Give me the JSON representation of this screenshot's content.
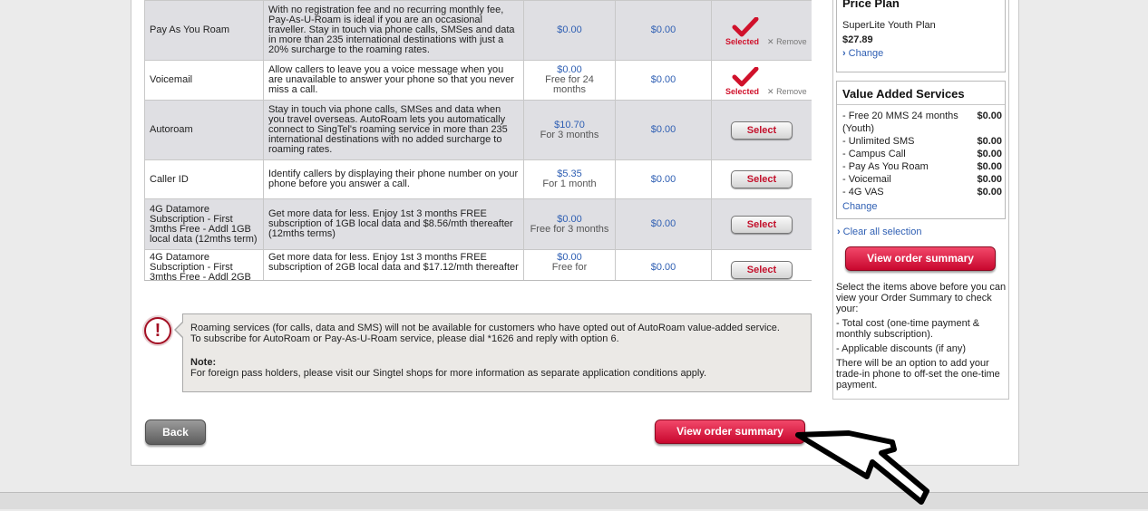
{
  "services": [
    {
      "name": "Pay As You Roam",
      "description": "With no registration fee and no recurring monthly fee, Pay-As-U-Roam is ideal if you are an occasional traveller. Stay in touch via phone calls, SMSes and data in more than 235 international destinations with just a 20% surcharge to the roaming rates.",
      "price": "$0.00",
      "price_note": "",
      "price2": "$0.00",
      "status": "selected"
    },
    {
      "name": "Voicemail",
      "description": "Allow callers to leave you a voice message when you are unavailable to answer your phone so that you never miss a call.",
      "price": "$0.00",
      "price_note": "Free for 24 months",
      "price2": "$0.00",
      "status": "selected"
    },
    {
      "name": "Autoroam",
      "description": "Stay in touch via phone calls, SMSes and data when you travel overseas. AutoRoam lets you automatically connect to SingTel's roaming service in more than 235 international destinations with no added surcharge to roaming rates.",
      "price": "$10.70",
      "price_note": "For 3 months",
      "price2": "$0.00",
      "status": "select"
    },
    {
      "name": "Caller ID",
      "description": "Identify callers by displaying their phone number on your phone before you answer a call.",
      "price": "$5.35",
      "price_note": "For 1 month",
      "price2": "$0.00",
      "status": "select"
    },
    {
      "name": "4G Datamore Subscription - First 3mths Free - Addl 1GB local data (12mths term)",
      "description": "Get more data for less. Enjoy 1st 3 months FREE subscription of 1GB local data and $8.56/mth thereafter (12mths terms)",
      "price": "$0.00",
      "price_note": "Free for 3 months",
      "price2": "$0.00",
      "status": "select"
    },
    {
      "name": "4G Datamore Subscription - First 3mths Free - Addl 2GB",
      "description": "Get more data for less. Enjoy 1st 3 months FREE subscription of 2GB local data and $17.12/mth thereafter",
      "price": "$0.00",
      "price_note": "Free for",
      "price2": "$0.00",
      "status": "select"
    }
  ],
  "labels": {
    "selected": "Selected",
    "remove": "Remove",
    "select": "Select"
  },
  "notice": {
    "line1": "Roaming services (for calls, data and SMS) will not be available for customers who have opted out of AutoRoam value-added service.",
    "line2": "To subscribe for AutoRoam or Pay-As-U-Roam service, please dial *1626 and reply with option 6.",
    "note_title": "Note:",
    "note_text": "For foreign pass holders, please visit our Singtel shops for more information as separate application conditions apply.",
    "icon": "exclamation-icon"
  },
  "buttons": {
    "back": "Back",
    "view_order_summary": "View order summary"
  },
  "price_plan": {
    "title": "Price Plan",
    "plan_name": "SuperLite Youth Plan",
    "price": "$27.89",
    "change": "Change"
  },
  "vas": {
    "title": "Value Added Services",
    "items": [
      {
        "name": "- Free 20 MMS 24 months (Youth)",
        "price": "$0.00"
      },
      {
        "name": "- Unlimited SMS",
        "price": "$0.00"
      },
      {
        "name": "- Campus Call",
        "price": "$0.00"
      },
      {
        "name": "- Pay As You Roam",
        "price": "$0.00"
      },
      {
        "name": "- Voicemail",
        "price": "$0.00"
      },
      {
        "name": "- 4G VAS",
        "price": "$0.00"
      }
    ],
    "change": "Change",
    "clear_all": "Clear all selection"
  },
  "info": {
    "intro": "Select the items above before you can view your Order Summary to check your:",
    "point1": "- Total cost (one-time payment & monthly subscription).",
    "point2": "- Applicable discounts (if any)",
    "outro": "There will be an option to add your trade-in phone to off-set the one-time payment."
  },
  "colors": {
    "accent_red": "#d0112b",
    "link_blue": "#2f5fb3",
    "row_shade": "#dfdfe3"
  }
}
